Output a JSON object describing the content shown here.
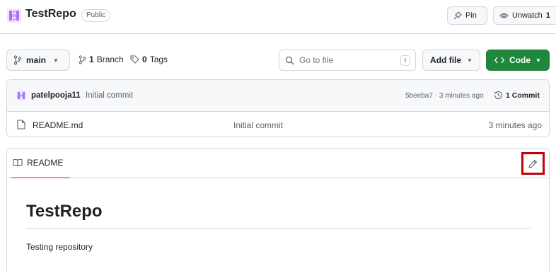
{
  "repo": {
    "name": "TestRepo",
    "visibility": "Public",
    "pin_label": "Pin",
    "watch_label": "Unwatch",
    "watch_count": "1"
  },
  "toolbar": {
    "branch": "main",
    "branch_count": "1",
    "branch_label": "Branch",
    "tag_count": "0",
    "tag_label": "Tags",
    "search_placeholder": "Go to file",
    "search_shortcut": "t",
    "add_file_label": "Add file",
    "code_label": "Code"
  },
  "latest_commit": {
    "author": "patelpooja11",
    "message": "Initial commit",
    "hash_time": "5beeba7 · 3 minutes ago",
    "commit_count_label": "1 Commit"
  },
  "files": [
    {
      "name": "README.md",
      "commit": "Initial commit",
      "time": "3 minutes ago"
    }
  ],
  "readme": {
    "tab_label": "README",
    "heading": "TestRepo",
    "body": "Testing repository"
  },
  "colors": {
    "accent_green": "#1f883d",
    "avatar_purple": "#a371f7",
    "highlight_red": "#c0000a",
    "tab_underline": "#fd8c73"
  }
}
